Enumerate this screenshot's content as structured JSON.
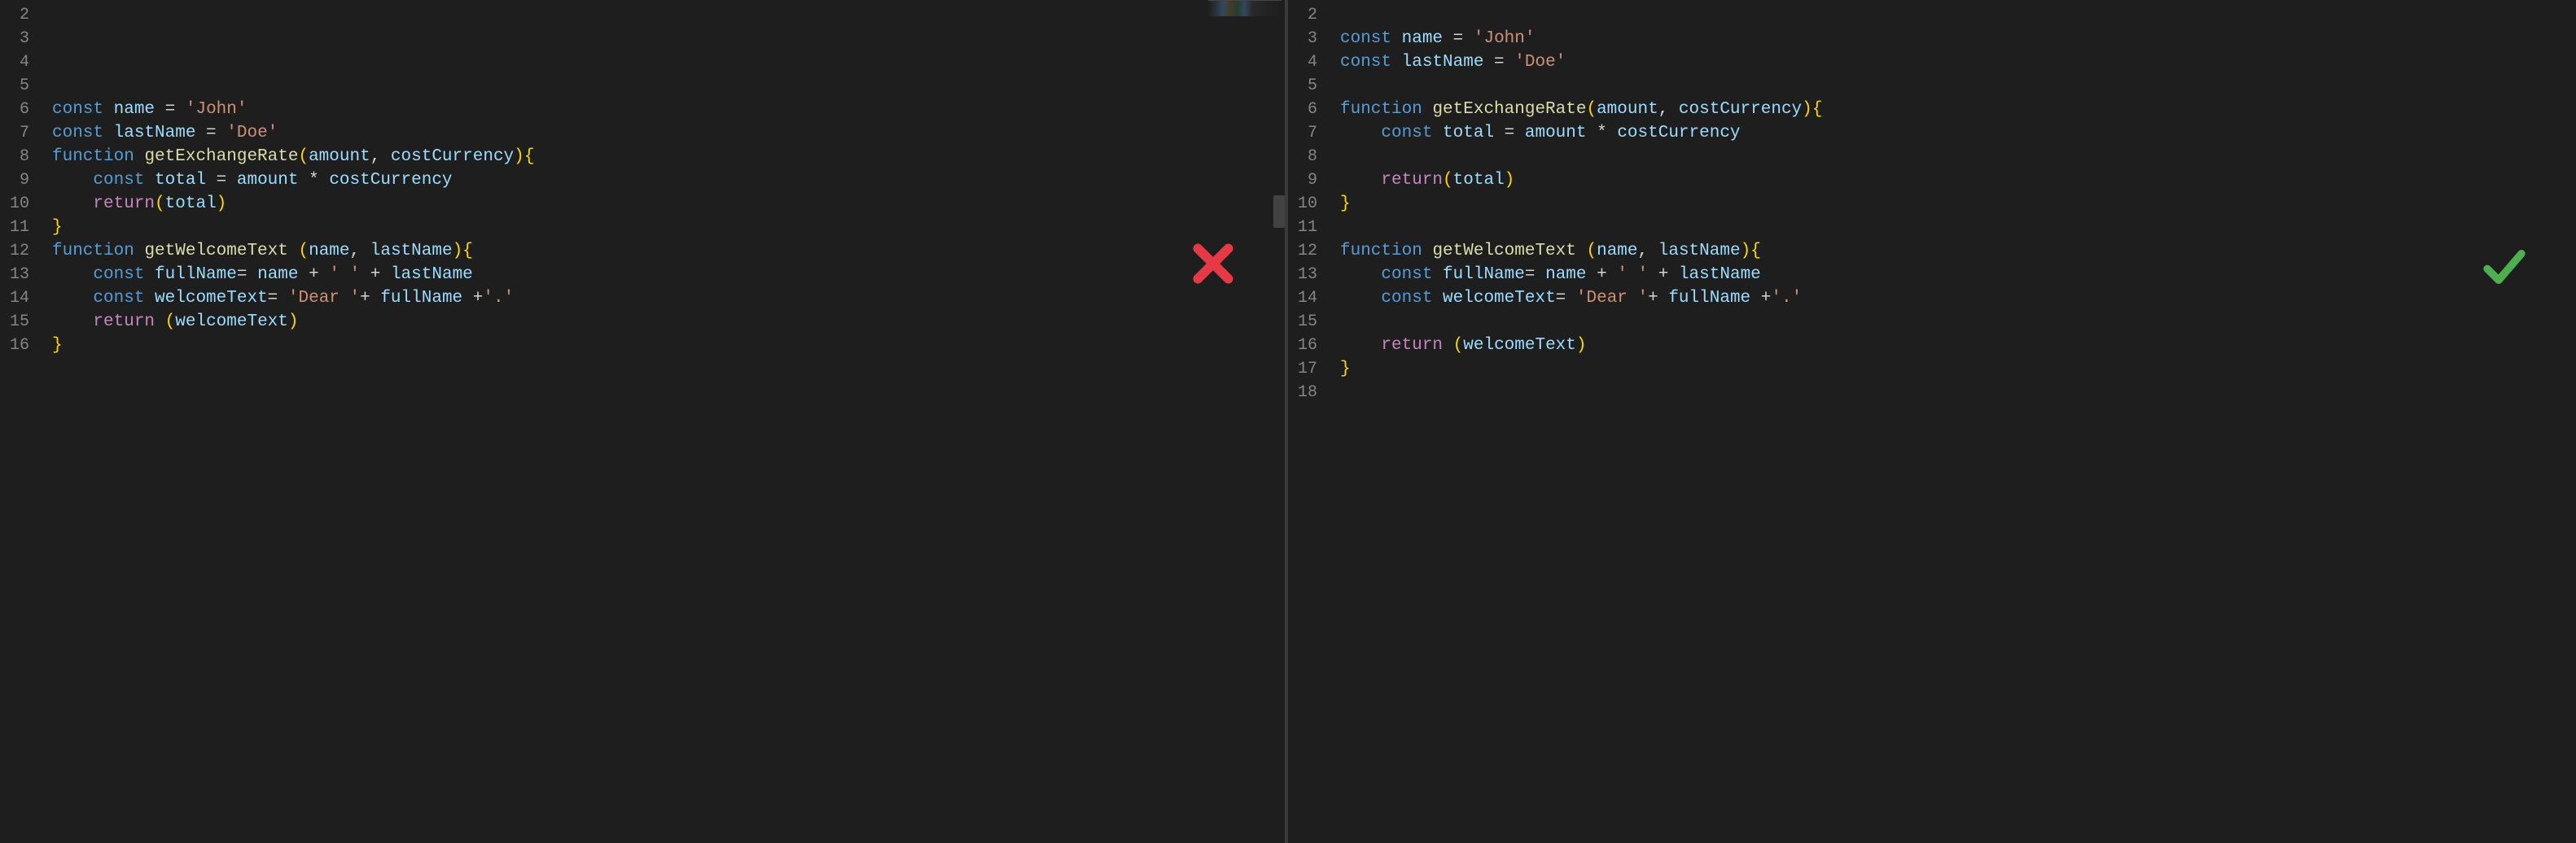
{
  "colors": {
    "background": "#1e1e1e",
    "keyword": "#569cd6",
    "function": "#dcdcaa",
    "variable": "#9cdcfe",
    "string": "#ce9178",
    "operator": "#d4d4d4",
    "return": "#c586c0",
    "bracket1": "#ffd700",
    "bracket2": "#da70d6",
    "lineNumber": "#858585",
    "crossIcon": "#e63946",
    "checkIcon": "#4caf50"
  },
  "icons": {
    "cross": "incorrect",
    "check": "correct"
  },
  "left": {
    "mark": "cross",
    "startLine": 2,
    "lines": [
      [],
      [
        {
          "t": "kw",
          "v": "const"
        },
        {
          "t": "op",
          "v": " "
        },
        {
          "t": "var",
          "v": "name"
        },
        {
          "t": "op",
          "v": " = "
        },
        {
          "t": "str",
          "v": "'John'"
        }
      ],
      [
        {
          "t": "kw",
          "v": "const"
        },
        {
          "t": "op",
          "v": " "
        },
        {
          "t": "var",
          "v": "lastName"
        },
        {
          "t": "op",
          "v": " = "
        },
        {
          "t": "str",
          "v": "'Doe'"
        }
      ],
      [
        {
          "t": "kw",
          "v": "function"
        },
        {
          "t": "op",
          "v": " "
        },
        {
          "t": "fn",
          "v": "getExchangeRate"
        },
        {
          "t": "paren",
          "v": "("
        },
        {
          "t": "var",
          "v": "amount"
        },
        {
          "t": "op",
          "v": ", "
        },
        {
          "t": "var",
          "v": "costCurrency"
        },
        {
          "t": "paren",
          "v": ")"
        },
        {
          "t": "brace",
          "v": "{"
        }
      ],
      [
        {
          "t": "op",
          "v": "    "
        },
        {
          "t": "kw",
          "v": "const"
        },
        {
          "t": "op",
          "v": " "
        },
        {
          "t": "var",
          "v": "total"
        },
        {
          "t": "op",
          "v": " = "
        },
        {
          "t": "var",
          "v": "amount"
        },
        {
          "t": "op",
          "v": " * "
        },
        {
          "t": "var",
          "v": "costCurrency"
        }
      ],
      [
        {
          "t": "op",
          "v": "    "
        },
        {
          "t": "ret",
          "v": "return"
        },
        {
          "t": "paren",
          "v": "("
        },
        {
          "t": "var",
          "v": "total"
        },
        {
          "t": "paren",
          "v": ")"
        }
      ],
      [
        {
          "t": "brace",
          "v": "}"
        }
      ],
      [
        {
          "t": "kw",
          "v": "function"
        },
        {
          "t": "op",
          "v": " "
        },
        {
          "t": "fn",
          "v": "getWelcomeText"
        },
        {
          "t": "op",
          "v": " "
        },
        {
          "t": "paren",
          "v": "("
        },
        {
          "t": "var",
          "v": "name"
        },
        {
          "t": "op",
          "v": ", "
        },
        {
          "t": "var",
          "v": "lastName"
        },
        {
          "t": "paren",
          "v": ")"
        },
        {
          "t": "brace",
          "v": "{"
        }
      ],
      [
        {
          "t": "op",
          "v": "    "
        },
        {
          "t": "kw",
          "v": "const"
        },
        {
          "t": "op",
          "v": " "
        },
        {
          "t": "var",
          "v": "fullName"
        },
        {
          "t": "op",
          "v": "= "
        },
        {
          "t": "var",
          "v": "name"
        },
        {
          "t": "op",
          "v": " + "
        },
        {
          "t": "str",
          "v": "' '"
        },
        {
          "t": "op",
          "v": " + "
        },
        {
          "t": "var",
          "v": "lastName"
        }
      ],
      [
        {
          "t": "op",
          "v": "    "
        },
        {
          "t": "kw",
          "v": "const"
        },
        {
          "t": "op",
          "v": " "
        },
        {
          "t": "var",
          "v": "welcomeText"
        },
        {
          "t": "op",
          "v": "= "
        },
        {
          "t": "str",
          "v": "'Dear '"
        },
        {
          "t": "op",
          "v": "+ "
        },
        {
          "t": "var",
          "v": "fullName"
        },
        {
          "t": "op",
          "v": " +"
        },
        {
          "t": "str",
          "v": "'.'"
        }
      ],
      [
        {
          "t": "op",
          "v": "    "
        },
        {
          "t": "ret",
          "v": "return"
        },
        {
          "t": "op",
          "v": " "
        },
        {
          "t": "paren",
          "v": "("
        },
        {
          "t": "var",
          "v": "welcomeText"
        },
        {
          "t": "paren",
          "v": ")"
        }
      ],
      [
        {
          "t": "brace",
          "v": "}"
        }
      ],
      [],
      [],
      []
    ]
  },
  "right": {
    "mark": "check",
    "startLine": 2,
    "lines": [
      [],
      [
        {
          "t": "kw",
          "v": "const"
        },
        {
          "t": "op",
          "v": " "
        },
        {
          "t": "var",
          "v": "name"
        },
        {
          "t": "op",
          "v": " = "
        },
        {
          "t": "str",
          "v": "'John'"
        }
      ],
      [
        {
          "t": "kw",
          "v": "const"
        },
        {
          "t": "op",
          "v": " "
        },
        {
          "t": "var",
          "v": "lastName"
        },
        {
          "t": "op",
          "v": " = "
        },
        {
          "t": "str",
          "v": "'Doe'"
        }
      ],
      [],
      [
        {
          "t": "kw",
          "v": "function"
        },
        {
          "t": "op",
          "v": " "
        },
        {
          "t": "fn",
          "v": "getExchangeRate"
        },
        {
          "t": "paren",
          "v": "("
        },
        {
          "t": "var",
          "v": "amount"
        },
        {
          "t": "op",
          "v": ", "
        },
        {
          "t": "var",
          "v": "costCurrency"
        },
        {
          "t": "paren",
          "v": ")"
        },
        {
          "t": "brace",
          "v": "{"
        }
      ],
      [
        {
          "t": "op",
          "v": "    "
        },
        {
          "t": "kw",
          "v": "const"
        },
        {
          "t": "op",
          "v": " "
        },
        {
          "t": "var",
          "v": "total"
        },
        {
          "t": "op",
          "v": " = "
        },
        {
          "t": "var",
          "v": "amount"
        },
        {
          "t": "op",
          "v": " * "
        },
        {
          "t": "var",
          "v": "costCurrency"
        }
      ],
      [],
      [
        {
          "t": "op",
          "v": "    "
        },
        {
          "t": "ret",
          "v": "return"
        },
        {
          "t": "paren",
          "v": "("
        },
        {
          "t": "var",
          "v": "total"
        },
        {
          "t": "paren",
          "v": ")"
        }
      ],
      [
        {
          "t": "brace",
          "v": "}"
        }
      ],
      [],
      [
        {
          "t": "kw",
          "v": "function"
        },
        {
          "t": "op",
          "v": " "
        },
        {
          "t": "fn",
          "v": "getWelcomeText"
        },
        {
          "t": "op",
          "v": " "
        },
        {
          "t": "paren",
          "v": "("
        },
        {
          "t": "var",
          "v": "name"
        },
        {
          "t": "op",
          "v": ", "
        },
        {
          "t": "var",
          "v": "lastName"
        },
        {
          "t": "paren",
          "v": ")"
        },
        {
          "t": "brace",
          "v": "{"
        }
      ],
      [
        {
          "t": "op",
          "v": "    "
        },
        {
          "t": "kw",
          "v": "const"
        },
        {
          "t": "op",
          "v": " "
        },
        {
          "t": "var",
          "v": "fullName"
        },
        {
          "t": "op",
          "v": "= "
        },
        {
          "t": "var",
          "v": "name"
        },
        {
          "t": "op",
          "v": " + "
        },
        {
          "t": "str",
          "v": "' '"
        },
        {
          "t": "op",
          "v": " + "
        },
        {
          "t": "var",
          "v": "lastName"
        }
      ],
      [
        {
          "t": "op",
          "v": "    "
        },
        {
          "t": "kw",
          "v": "const"
        },
        {
          "t": "op",
          "v": " "
        },
        {
          "t": "var",
          "v": "welcomeText"
        },
        {
          "t": "op",
          "v": "= "
        },
        {
          "t": "str",
          "v": "'Dear '"
        },
        {
          "t": "op",
          "v": "+ "
        },
        {
          "t": "var",
          "v": "fullName"
        },
        {
          "t": "op",
          "v": " +"
        },
        {
          "t": "str",
          "v": "'.'"
        }
      ],
      [],
      [
        {
          "t": "op",
          "v": "    "
        },
        {
          "t": "ret",
          "v": "return"
        },
        {
          "t": "op",
          "v": " "
        },
        {
          "t": "paren",
          "v": "("
        },
        {
          "t": "var",
          "v": "welcomeText"
        },
        {
          "t": "paren",
          "v": ")"
        }
      ],
      [
        {
          "t": "brace",
          "v": "}"
        }
      ],
      []
    ]
  }
}
